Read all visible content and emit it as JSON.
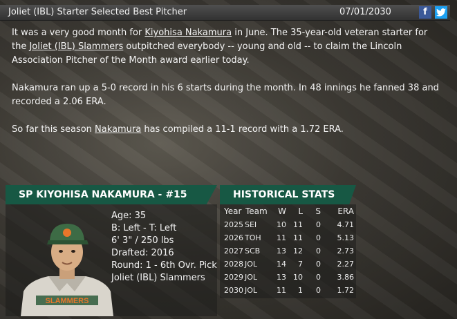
{
  "header": {
    "title": "Joliet (IBL) Starter Selected Best Pitcher",
    "date": "07/01/2030",
    "facebook_glyph": "f",
    "twitter_glyph": "🐦"
  },
  "article": {
    "p1": {
      "pre": "It was a very good month for ",
      "link1": "Kiyohisa Nakamura",
      "mid": " in June. The 35-year-old veteran starter for the ",
      "link2": "Joliet (IBL) Slammers",
      "post": " outpitched everybody -- young and old -- to claim the Lincoln Association Pitcher of the Month award earlier today."
    },
    "p2": "Nakamura ran up a 5-0 record in his 6 starts during the month. In 48 innings he fanned 38 and recorded a 2.06 ERA.",
    "p3": {
      "pre": "So far this season ",
      "link": "Nakamura",
      "post": " has compiled a 11-1 record with a 1.72 ERA."
    }
  },
  "player": {
    "banner": "SP KIYOHISA NAKAMURA - #15",
    "bio": [
      "Age: 35",
      "B: Left - T: Left",
      "6' 3\" / 250 lbs",
      "Drafted: 2016",
      "Round: 1 - 6th Ovr. Pick",
      "Joliet (IBL) Slammers"
    ],
    "jersey_text": "SLAMMERS"
  },
  "stats": {
    "banner": "HISTORICAL STATS",
    "headers": [
      "Year",
      "Team",
      "W",
      "L",
      "S",
      "ERA"
    ],
    "rows": [
      [
        "2025",
        "SEI",
        "10",
        "11",
        "0",
        "4.71"
      ],
      [
        "2026",
        "TOH",
        "11",
        "11",
        "0",
        "5.13"
      ],
      [
        "2027",
        "SCB",
        "13",
        "12",
        "0",
        "2.73"
      ],
      [
        "2028",
        "JOL",
        "14",
        "7",
        "0",
        "2.27"
      ],
      [
        "2029",
        "JOL",
        "13",
        "10",
        "0",
        "3.86"
      ],
      [
        "2030",
        "JOL",
        "11",
        "1",
        "0",
        "1.72"
      ]
    ]
  }
}
